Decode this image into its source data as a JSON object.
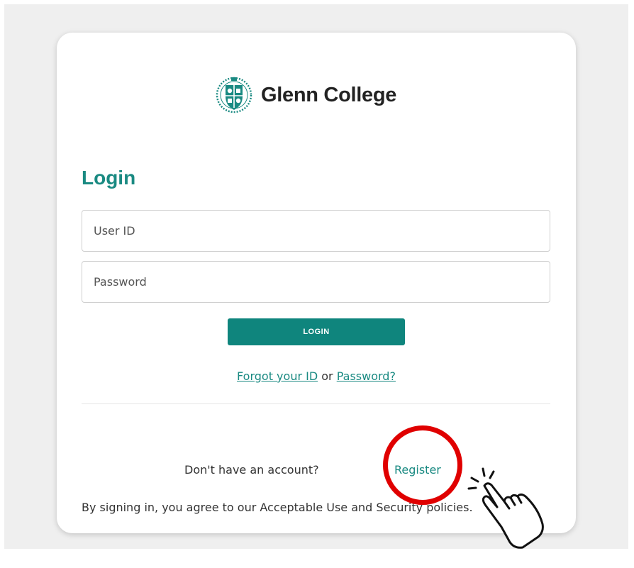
{
  "brand": {
    "name": "Glenn College",
    "logo_icon": "college-crest-icon",
    "accent_color": "#1a8a82"
  },
  "login": {
    "title": "Login",
    "user_id_placeholder": "User ID",
    "password_placeholder": "Password",
    "button_label": "LOGIN",
    "button_color": "#0f857d"
  },
  "recovery": {
    "forgot_id_label": "Forgot your ID",
    "or_text": "or",
    "password_label": "Password?"
  },
  "signup": {
    "prompt": "Don't have an account?",
    "register_label": "Register"
  },
  "terms_text": "By signing in, you agree to our Acceptable Use and Security policies.",
  "annotations": {
    "highlight_color": "#e00000",
    "pointer_icon": "pointing-hand-click-icon"
  }
}
